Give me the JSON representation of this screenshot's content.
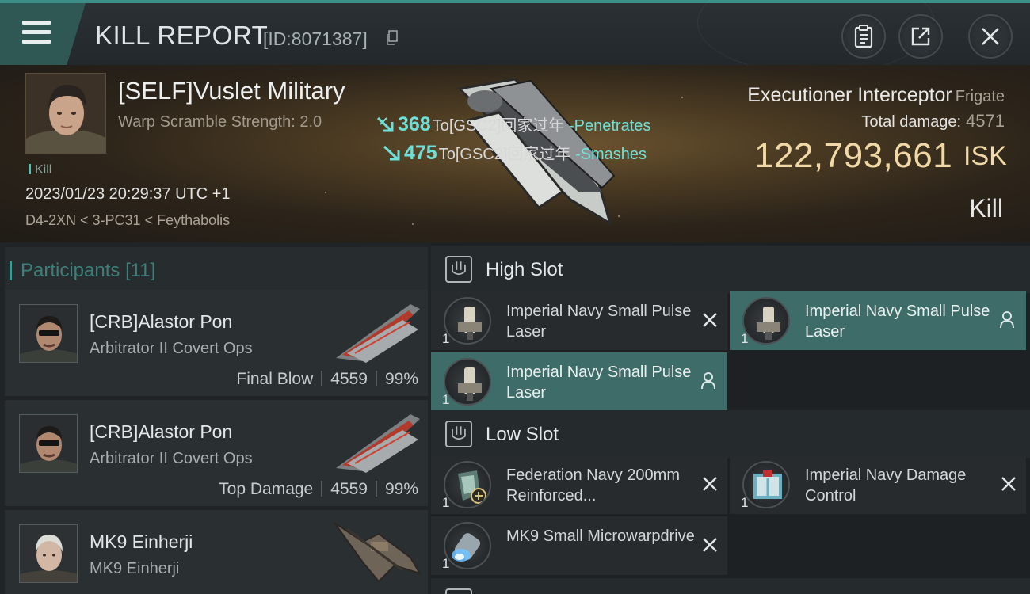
{
  "header": {
    "title": "KILL REPORT",
    "report_id": "[ID:8071387]",
    "menu_icon": "hamburger-icon",
    "actions": [
      {
        "name": "clipboard-icon"
      },
      {
        "name": "share-icon"
      },
      {
        "name": "close-icon"
      }
    ]
  },
  "victim": {
    "name": "[SELF]Vuslet Military",
    "warp_scramble": "Warp Scramble Strength: 2.0",
    "kill_label": "Kill",
    "datetime": "2023/01/23 20:29:37 UTC +1",
    "location": "D4-2XN < 3-PC31 < Feythabolis"
  },
  "hits": [
    {
      "amount": "368",
      "target": "To[GSC2]回家过年",
      "verb": "-Penetrates"
    },
    {
      "amount": "475",
      "target": "To[GSC2]回家过年",
      "verb": "-Smashes"
    }
  ],
  "ship": {
    "name": "Executioner Interceptor",
    "class": "Frigate",
    "total_damage_label": "Total damage:",
    "total_damage": "4571",
    "isk_value": "122,793,661",
    "isk_unit": "ISK",
    "kill_type": "Kill"
  },
  "participants": {
    "title": "Participants",
    "count": "[11]",
    "rows": [
      {
        "name": "[CRB]Alastor Pon",
        "ship": "Arbitrator II Covert Ops",
        "role": "Final Blow",
        "damage": "4559",
        "percent": "99%"
      },
      {
        "name": "[CRB]Alastor Pon",
        "ship": "Arbitrator II Covert Ops",
        "role": "Top Damage",
        "damage": "4559",
        "percent": "99%"
      },
      {
        "name": "MK9 Einherji",
        "ship": "MK9 Einherji"
      }
    ]
  },
  "slots": {
    "high": {
      "title": "High Slot",
      "modules": [
        {
          "name": "Imperial Navy Small Pulse Laser",
          "qty": "1",
          "status": "destroyed"
        },
        {
          "name": "Imperial Navy Small Pulse Laser",
          "qty": "1",
          "status": "dropped"
        },
        {
          "name": "Imperial Navy Small Pulse Laser",
          "qty": "1",
          "status": "dropped"
        }
      ]
    },
    "low": {
      "title": "Low Slot",
      "modules": [
        {
          "name": "Federation Navy 200mm Reinforced...",
          "qty": "1",
          "status": "destroyed"
        },
        {
          "name": "Imperial Navy Damage Control",
          "qty": "1",
          "status": "destroyed"
        },
        {
          "name": "MK9 Small Microwarpdrive",
          "qty": "1",
          "status": "destroyed"
        }
      ]
    }
  },
  "colors": {
    "accent": "#3c8f88",
    "isk_gold": "#f0d9a6",
    "hit_cyan": "#6fe0d8",
    "dropped_bg": "#3e6c68"
  }
}
